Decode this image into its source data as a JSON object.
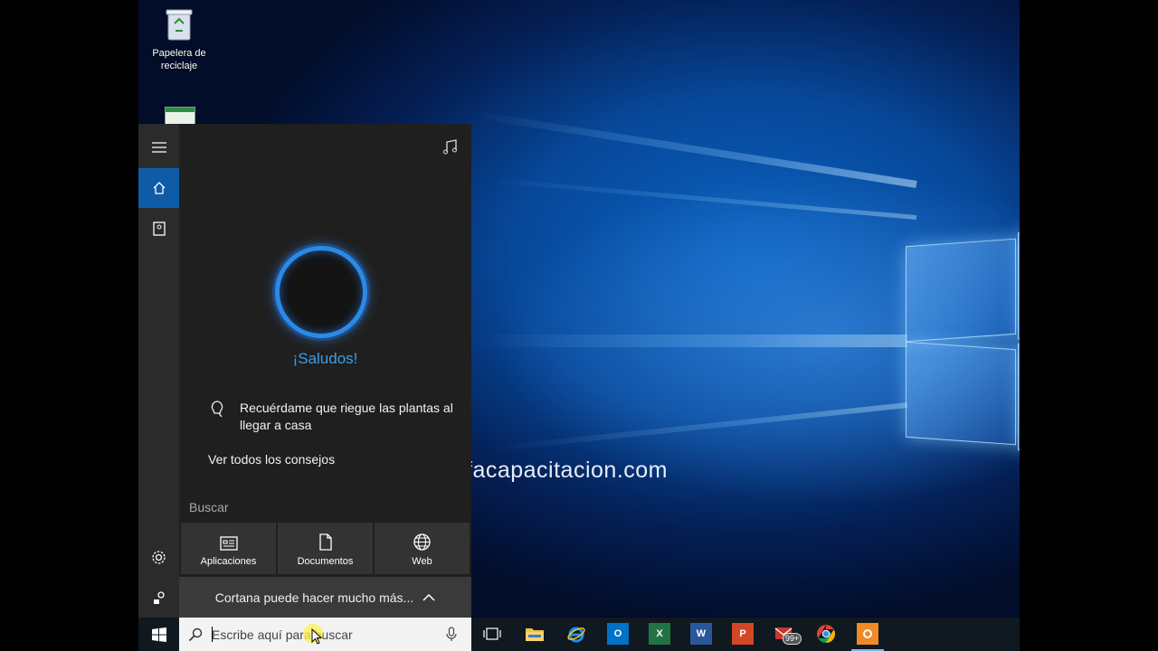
{
  "desktop": {
    "recycle_bin_label": "Papelera de reciclaje",
    "watermark_text": "facapacitacion.com"
  },
  "cortana": {
    "rail": {
      "menu_icon": "hamburger-icon",
      "home_icon": "home-icon",
      "notebook_icon": "notebook-icon",
      "settings_icon": "gear-icon",
      "feedback_icon": "feedback-icon"
    },
    "music_icon": "music-note-icon",
    "greeting": "¡Saludos!",
    "tip": "Recuérdame que riegue las plantas al llegar a casa",
    "see_all_tips": "Ver todos los consejos",
    "search_section_label": "Buscar",
    "filters": [
      {
        "label": "Aplicaciones",
        "icon": "apps-icon"
      },
      {
        "label": "Documentos",
        "icon": "document-icon"
      },
      {
        "label": "Web",
        "icon": "globe-icon"
      }
    ],
    "more_label": "Cortana puede hacer mucho más..."
  },
  "taskbar": {
    "search_placeholder": "Escribe aquí para buscar",
    "pinned": [
      {
        "name": "task-view",
        "icon": "task-view-icon"
      },
      {
        "name": "file-explorer",
        "icon": "folder-icon"
      },
      {
        "name": "internet-explorer",
        "icon": "ie-icon"
      },
      {
        "name": "outlook",
        "icon": "outlook-icon",
        "letter": "O",
        "color": "#0072c6"
      },
      {
        "name": "excel",
        "icon": "excel-icon",
        "letter": "X",
        "color": "#217346"
      },
      {
        "name": "word",
        "icon": "word-icon",
        "letter": "W",
        "color": "#2b579a"
      },
      {
        "name": "powerpoint",
        "icon": "powerpoint-icon",
        "letter": "P",
        "color": "#d24726"
      },
      {
        "name": "mail",
        "icon": "mail-icon",
        "badge": "99+"
      },
      {
        "name": "chrome",
        "icon": "chrome-icon"
      },
      {
        "name": "app",
        "icon": "app-icon",
        "color": "#f08a24"
      }
    ]
  },
  "colors": {
    "accent": "#0f5ba8",
    "cortana_blue": "#3b9ee8",
    "panel_bg": "#1f1f1f",
    "rail_bg": "#2b2b2b"
  }
}
